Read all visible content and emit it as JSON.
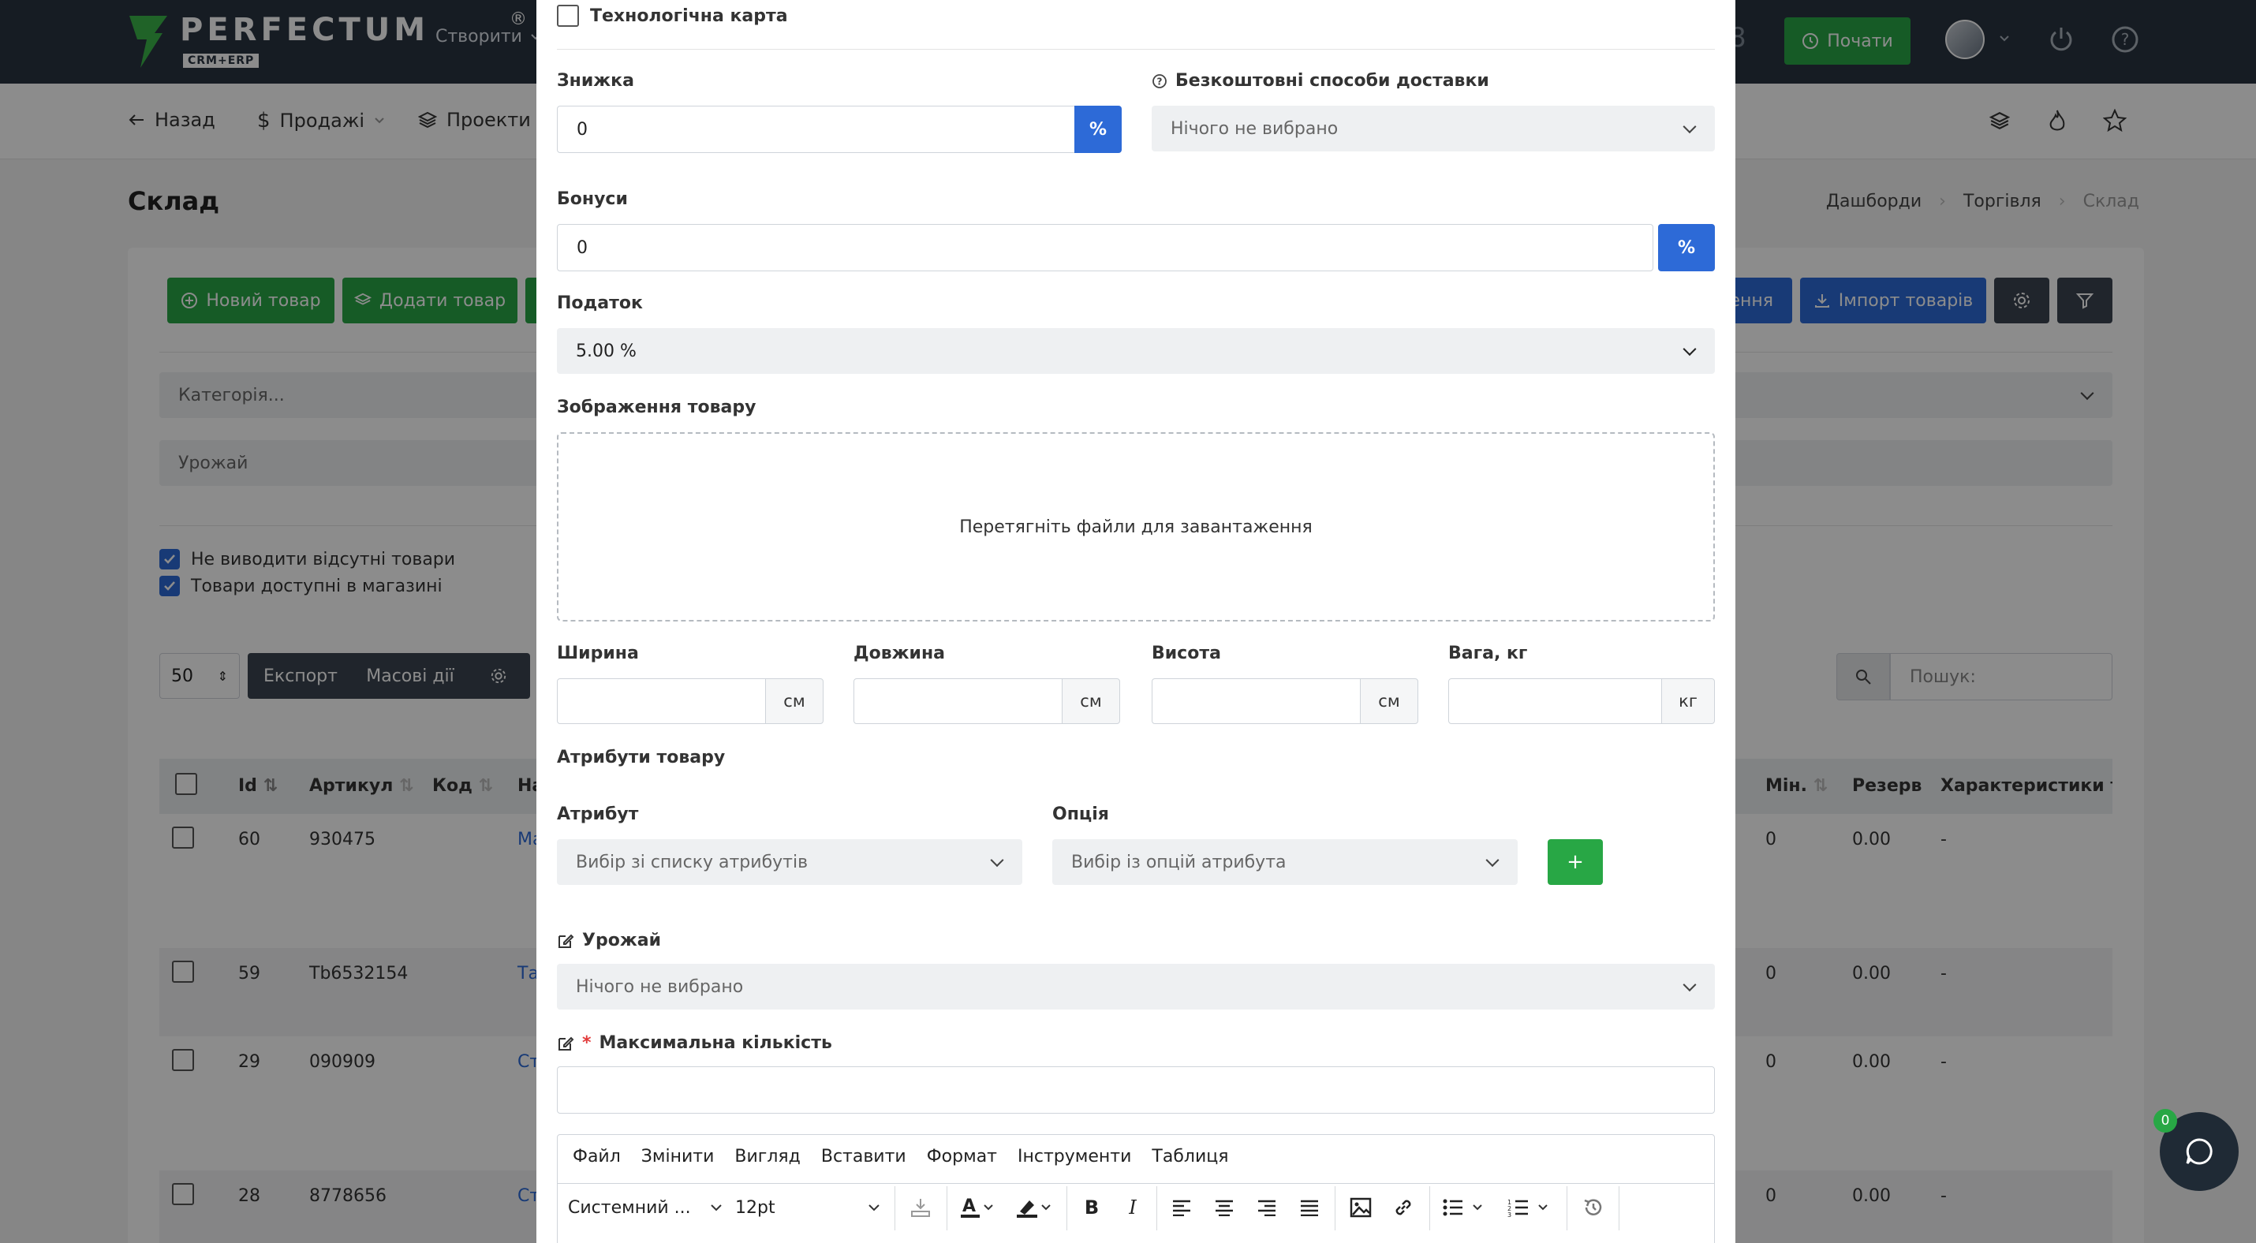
{
  "app": {
    "brand": "PERFECTUM",
    "brand_sub": "CRM+ERP",
    "reg": "®"
  },
  "topbar": {
    "create_label": "Створити",
    "start_label": "Почати",
    "hidden_digit": "8"
  },
  "subnav": {
    "back": "Назад",
    "sales": "Продажі",
    "projects": "Проекти"
  },
  "page": {
    "title": "Склад",
    "breadcrumb": [
      "Дашборди",
      "Торгівля",
      "Склад"
    ]
  },
  "toolbar": {
    "new_product": "Новий товар",
    "add_product": "Додати товар",
    "partial_label": "ення",
    "import_label": "Імпорт товарів"
  },
  "filters": {
    "category_placeholder": "Категорія...",
    "harvest_placeholder": "Урожай",
    "hide_absent": "Не виводити відсутні товари",
    "available_in_shop": "Товари доступні в магазині"
  },
  "list_controls": {
    "page_size": "50",
    "export": "Експорт",
    "bulk": "Масові дії",
    "search_placeholder": "Пошук:"
  },
  "table": {
    "headers": {
      "id": "Id",
      "sku": "Артикул",
      "code": "Код",
      "name": "На",
      "min": "Мін.",
      "reserve": "Резерв",
      "chars": "Характеристики тов"
    },
    "rows": [
      {
        "id": "60",
        "sku": "930475",
        "name": "Ма",
        "min": "0",
        "reserve": "0.00",
        "chars": "-"
      },
      {
        "id": "59",
        "sku": "Tb6532154",
        "name": "Та",
        "min": "0",
        "reserve": "0.00",
        "chars": "-"
      },
      {
        "id": "29",
        "sku": "090909",
        "name": "Ст",
        "min": "0",
        "reserve": "0.00",
        "chars": "-"
      },
      {
        "id": "28",
        "sku": "8778656",
        "name": "Ст",
        "min": "0",
        "reserve": "0.00",
        "chars": "-"
      }
    ]
  },
  "modal": {
    "tech_card": "Технологічна карта",
    "discount_label": "Знижка",
    "discount_value": "0",
    "percent": "%",
    "free_delivery_label": "Безкоштовні способи доставки",
    "nothing_selected": "Нічого не вибрано",
    "bonus_label": "Бонуси",
    "bonus_value": "0",
    "tax_label": "Податок",
    "tax_value": "5.00 %",
    "image_label": "Зображення товару",
    "dropzone_text": "Перетягніть файли для завантаження",
    "width_label": "Ширина",
    "length_label": "Довжина",
    "height_label": "Висота",
    "weight_label": "Вага, кг",
    "cm": "см",
    "kg": "кг",
    "attributes_label": "Атрибути товару",
    "attribute_label": "Атрибут",
    "option_label": "Опція",
    "attribute_placeholder": "Вибір зі списку атрибутів",
    "option_placeholder": "Вибір із опцій атрибута",
    "add": "+",
    "harvest_label": "Урожай",
    "harvest_value": "Нічого не вибрано",
    "max_qty_label": "Максимальна кількість",
    "required_star": "*"
  },
  "editor": {
    "menu": [
      "Файл",
      "Змінити",
      "Вигляд",
      "Вставити",
      "Формат",
      "Інструменти",
      "Таблиця"
    ],
    "font_family": "Системний ...",
    "font_size": "12pt"
  },
  "chat": {
    "badge": "0"
  }
}
